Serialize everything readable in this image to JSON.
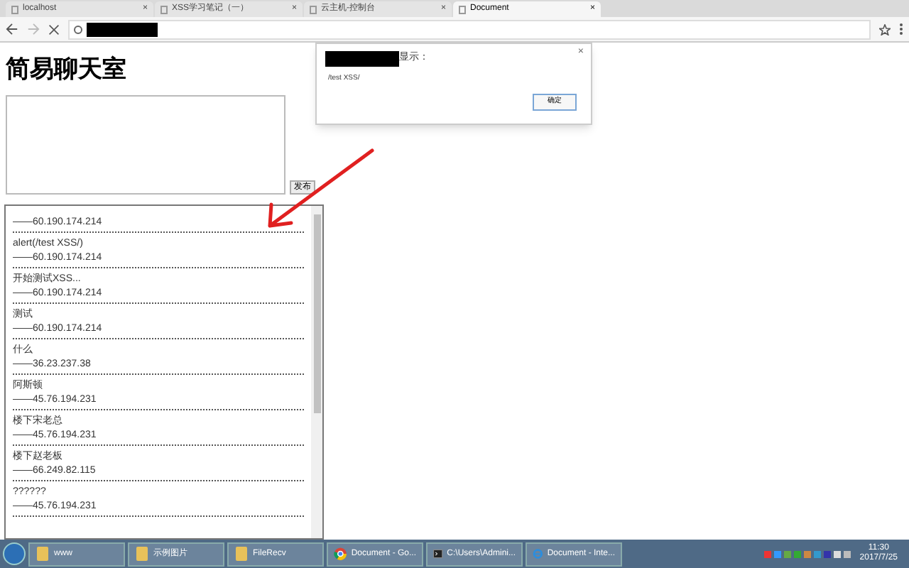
{
  "tabs": [
    {
      "title": "localhost",
      "close": "×",
      "selected": false
    },
    {
      "title": "XSS学习笔记（一）",
      "close": "×",
      "selected": false
    },
    {
      "title": "云主机-控制台",
      "close": "×",
      "selected": false
    },
    {
      "title": "Document",
      "close": "×",
      "selected": true
    }
  ],
  "page": {
    "heading": "简易聊天室",
    "submit": "发布"
  },
  "messages": [
    {
      "ip": "——60.190.174.214"
    },
    {
      "text": "alert(/test XSS/)",
      "ip": "——60.190.174.214"
    },
    {
      "text": "开始测试XSS...",
      "ip": "——60.190.174.214"
    },
    {
      "text": "测试",
      "ip": "——60.190.174.214"
    },
    {
      "text": "什么",
      "ip": "——36.23.237.38"
    },
    {
      "text": "阿斯顿",
      "ip": "——45.76.194.231"
    },
    {
      "text": "楼下宋老总",
      "ip": "——45.76.194.231"
    },
    {
      "text": "楼下赵老板",
      "ip": "——66.249.82.115"
    },
    {
      "text": "??????",
      "ip": "——45.76.194.231"
    }
  ],
  "dialog": {
    "title": "显示：",
    "message": "/test XSS/",
    "ok": "确定",
    "close": "×"
  },
  "taskbar": {
    "items": [
      {
        "label": "www",
        "kind": "folder"
      },
      {
        "label": "示例图片",
        "kind": "folder"
      },
      {
        "label": "FileRecv",
        "kind": "folder"
      },
      {
        "label": "Document - Go...",
        "kind": "chrome"
      },
      {
        "label": "C:\\Users\\Admini...",
        "kind": "console"
      },
      {
        "label": "Document - Inte...",
        "kind": "ie"
      }
    ],
    "time": "11:30",
    "date": "2017/7/25"
  }
}
